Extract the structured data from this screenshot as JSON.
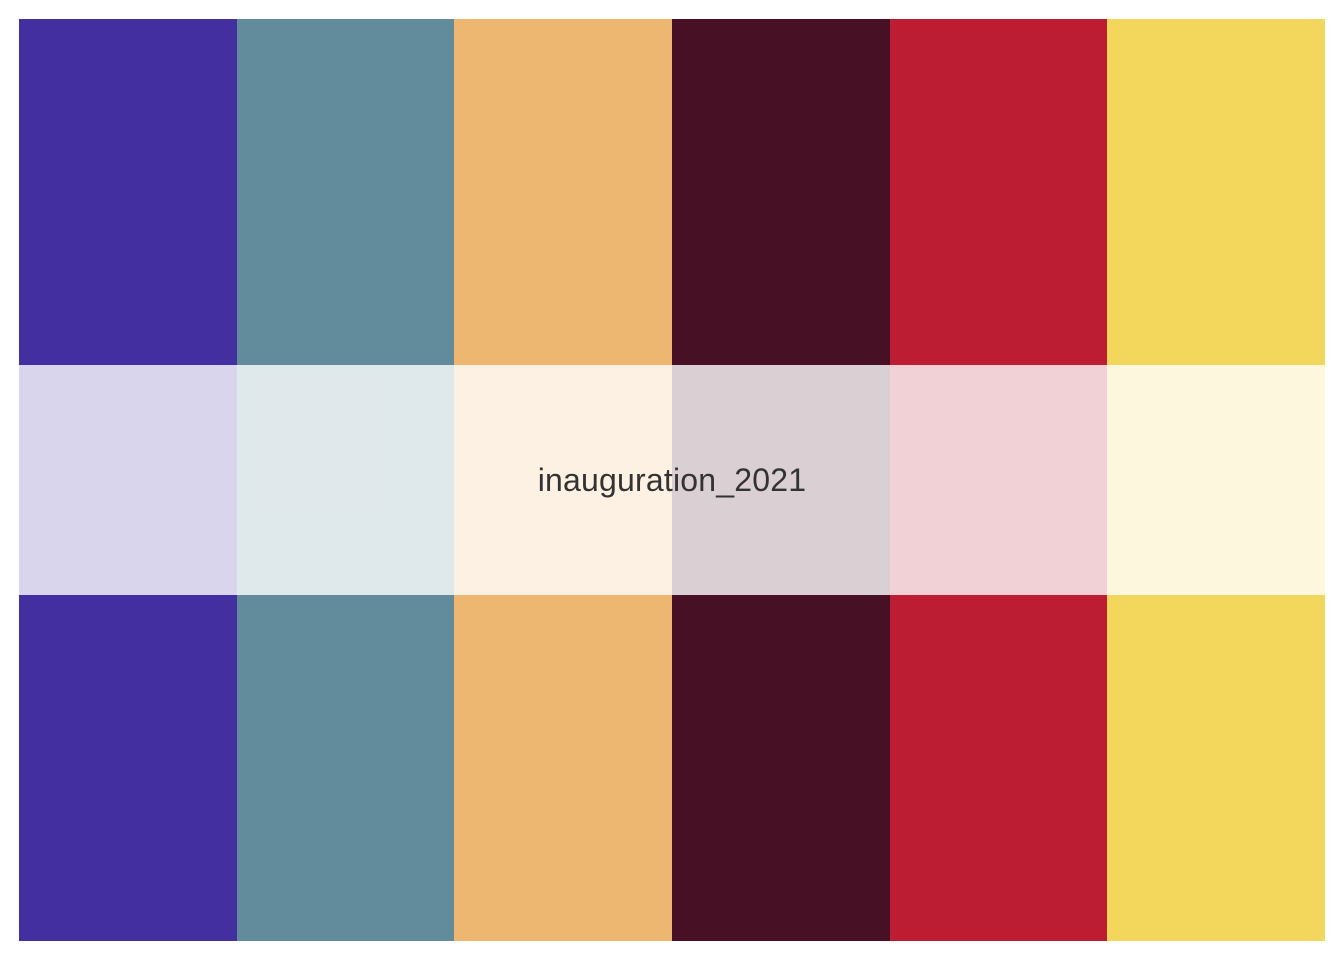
{
  "palette": {
    "name": "inauguration_2021",
    "colors": [
      "#432F9F",
      "#628B9C",
      "#EDB772",
      "#471024",
      "#BD1D32",
      "#F3D65C"
    ]
  }
}
